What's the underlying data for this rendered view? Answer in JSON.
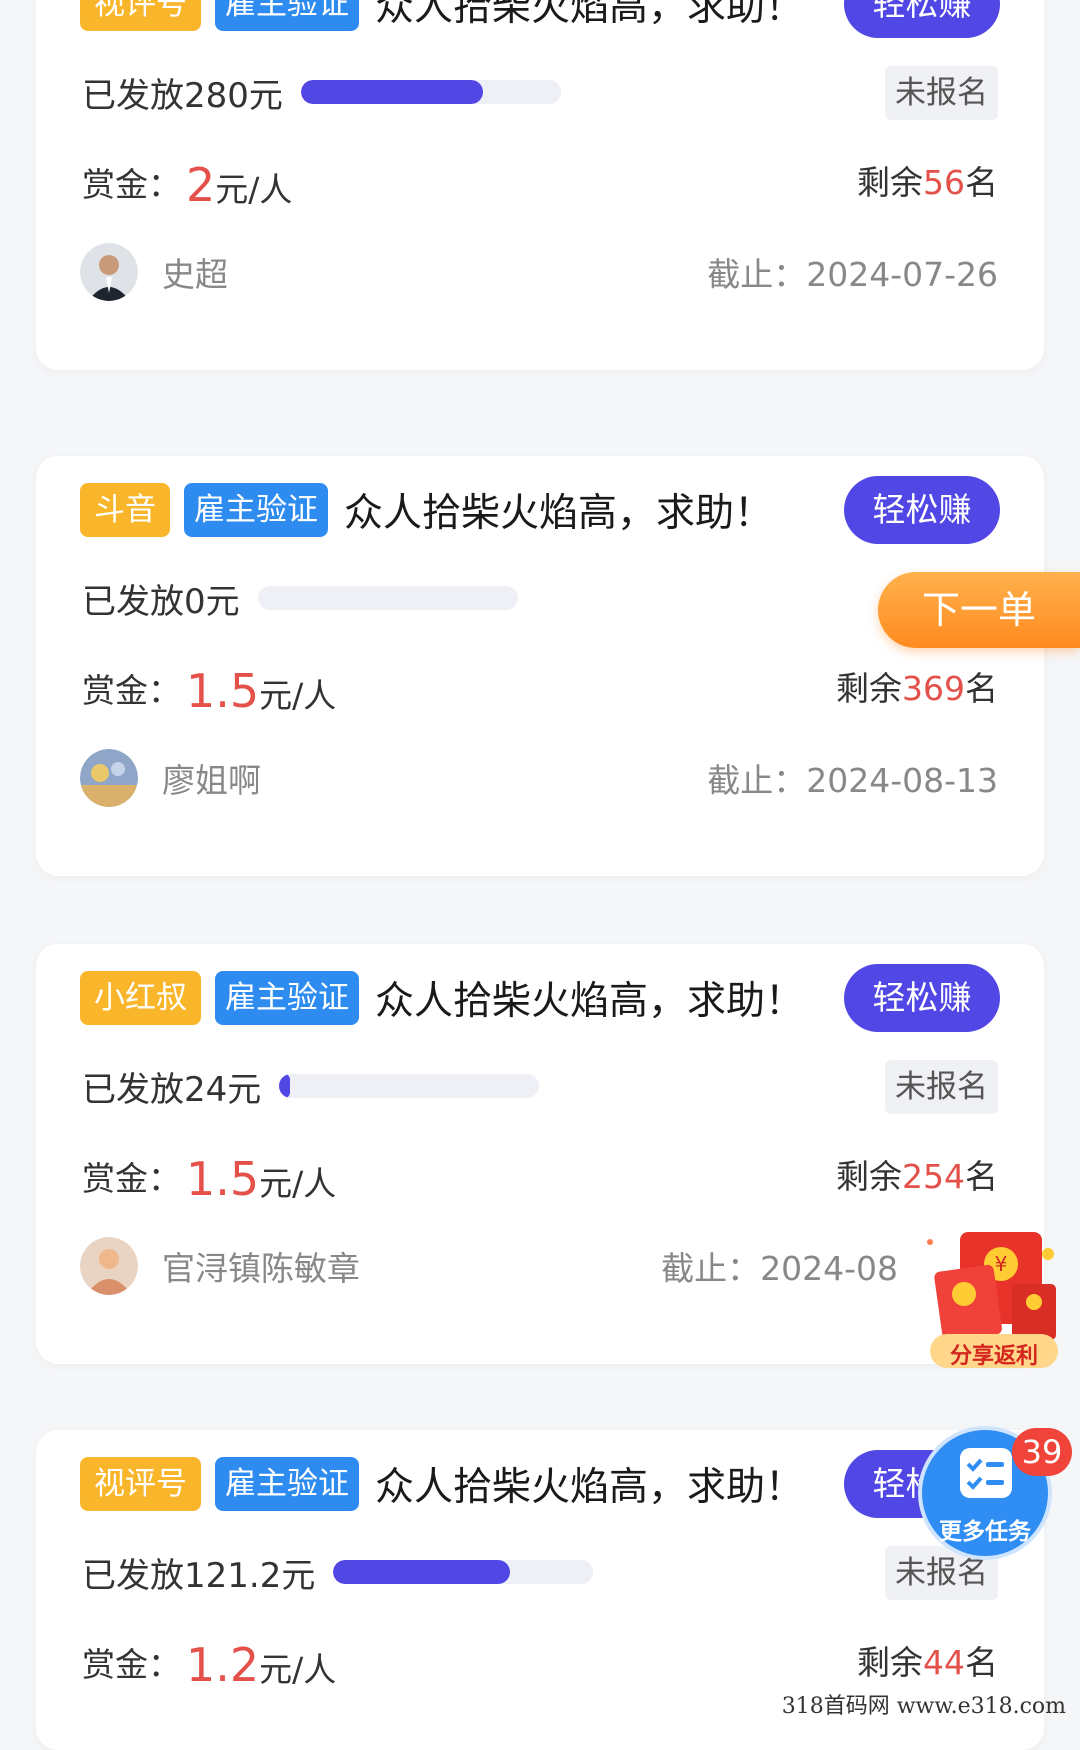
{
  "tasks": [
    {
      "platform": "视评号",
      "verify": "雇主验证",
      "title": "众人拾柴火焰高，求助！",
      "earn_label": "轻松赚",
      "issued": "已发放280元",
      "progress": 0.7,
      "status": "未报名",
      "reward_label": "赏金：",
      "reward_value": "2",
      "reward_unit": "元/人",
      "remain_prefix": "剩余",
      "remain_count": "56",
      "remain_suffix": "名",
      "user": "史超",
      "deadline": "截止：2024-07-26"
    },
    {
      "platform": "斗音",
      "verify": "雇主验证",
      "title": "众人拾柴火焰高，求助！",
      "earn_label": "轻松赚",
      "issued": "已发放0元",
      "progress": 0,
      "status": "",
      "reward_label": "赏金：",
      "reward_value": "1.5",
      "reward_unit": "元/人",
      "remain_prefix": "剩余",
      "remain_count": "369",
      "remain_suffix": "名",
      "user": "廖姐啊",
      "deadline": "截止：2024-08-13"
    },
    {
      "platform": "小红叔",
      "verify": "雇主验证",
      "title": "众人拾柴火焰高，求助！",
      "earn_label": "轻松赚",
      "issued": "已发放24元",
      "progress": 0.04,
      "status": "未报名",
      "reward_label": "赏金：",
      "reward_value": "1.5",
      "reward_unit": "元/人",
      "remain_prefix": "剩余",
      "remain_count": "254",
      "remain_suffix": "名",
      "user": "官浔镇陈敏章",
      "deadline": "截止：2024-08"
    },
    {
      "platform": "视评号",
      "verify": "雇主验证",
      "title": "众人拾柴火焰高，求助！",
      "earn_label": "轻松赚",
      "issued": "已发放121.2元",
      "progress": 0.68,
      "status": "未报名",
      "reward_label": "赏金：",
      "reward_value": "1.2",
      "reward_unit": "元/人",
      "remain_prefix": "剩余",
      "remain_count": "44",
      "remain_suffix": "名",
      "user": "",
      "deadline": ""
    }
  ],
  "floating": {
    "next_label": "下一单",
    "share_label": "分享返利",
    "more_label": "更多任务",
    "more_badge": "39"
  },
  "watermark": "318首码网 www.e318.com",
  "colors": {
    "accent": "#5147e5",
    "platform_tag": "#f9b62b",
    "verify_tag": "#2e8cf0",
    "price_red": "#e4504a"
  }
}
